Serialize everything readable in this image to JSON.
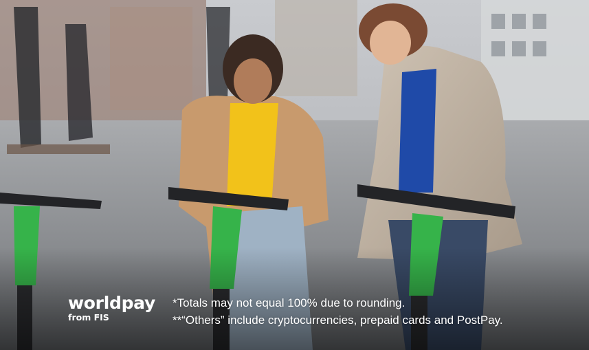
{
  "brand": {
    "name": "worldpay",
    "subline": "from FIS"
  },
  "footnotes": [
    "*Totals may not equal 100% due to rounding.",
    "**“Others” include cryptocurrencies, prepaid cards and PostPay."
  ],
  "colors": {
    "scooter_green": "#36b34a",
    "jacket_tan": "#c89a6d",
    "top_yellow": "#f2c21a",
    "top_blue": "#1f4aa8",
    "blazer_check": "#bdb0a0",
    "text": "#ffffff"
  }
}
